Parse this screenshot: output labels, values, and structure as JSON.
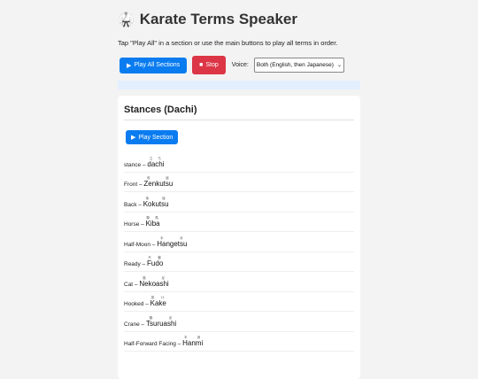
{
  "app": {
    "title": "Karate Terms Speaker",
    "title_icon": "karate-gi-icon"
  },
  "intro_text": "Tap \"Play All\" in a section or use the main buttons to play all terms in order.",
  "controls": {
    "play_all_label": "Play All Sections",
    "stop_label": "Stop",
    "voice_label": "Voice:",
    "voice_selected": "Both (English, then Japanese)"
  },
  "colors": {
    "primary": "#0a7cf0",
    "danger": "#dc3545",
    "status_bar": "#e3efff"
  },
  "section": {
    "title": "Stances (Dachi)",
    "play_label": "Play Section",
    "terms": [
      {
        "en": "stance",
        "jp": "dachi",
        "furigana": "立ち"
      },
      {
        "en": "Front",
        "jp": "Zenkutsu",
        "furigana": "前 屈"
      },
      {
        "en": "Back",
        "jp": "Kokutsu",
        "furigana": "後 屈"
      },
      {
        "en": "Horse",
        "jp": "Kiba",
        "furigana": "騎 馬"
      },
      {
        "en": "Half-Moon",
        "jp": "Hangetsu",
        "furigana": "半 月"
      },
      {
        "en": "Ready",
        "jp": "Fudo",
        "furigana": "不 動"
      },
      {
        "en": "Cat",
        "jp": "Nekoashi",
        "furigana": "猫 足"
      },
      {
        "en": "Hooked",
        "jp": "Kake",
        "furigana": "掛 け"
      },
      {
        "en": "Crane",
        "jp": "Tsuruashi",
        "furigana": "鶴 足"
      },
      {
        "en": "Half-Forward Facing",
        "jp": "Hanmi",
        "furigana": "半 身"
      }
    ]
  }
}
